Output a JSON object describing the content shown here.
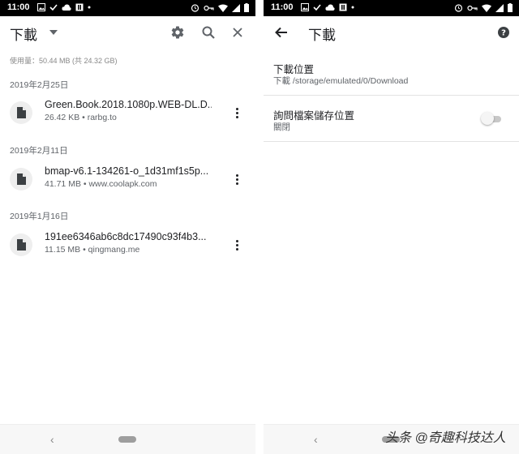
{
  "status_bar": {
    "time": "11:00"
  },
  "downloads_screen": {
    "title": "下載",
    "storage_usage": "使用量：50.44 MB (共 24.32 GB)",
    "groups": [
      {
        "date": "2019年2月25日",
        "name": "Green.Book.2018.1080p.WEB-DL.D...",
        "meta": "26.42 KB • rarbg.to"
      },
      {
        "date": "2019年2月11日",
        "name": "bmap-v6.1-134261-o_1d31mf1s5p...",
        "meta": "41.71 MB • www.coolapk.com"
      },
      {
        "date": "2019年1月16日",
        "name": "191ee6346ab6c8dc17490c93f4b3...",
        "meta": "11.15 MB • qingmang.me"
      }
    ]
  },
  "settings_screen": {
    "title": "下載",
    "download_location": {
      "label": "下載位置",
      "value": "下載 /storage/emulated/0/Download"
    },
    "ask_location": {
      "label": "詢問檔案儲存位置",
      "state": "關閉",
      "enabled": false
    }
  },
  "watermark": "头条 @奇趣科技达人"
}
